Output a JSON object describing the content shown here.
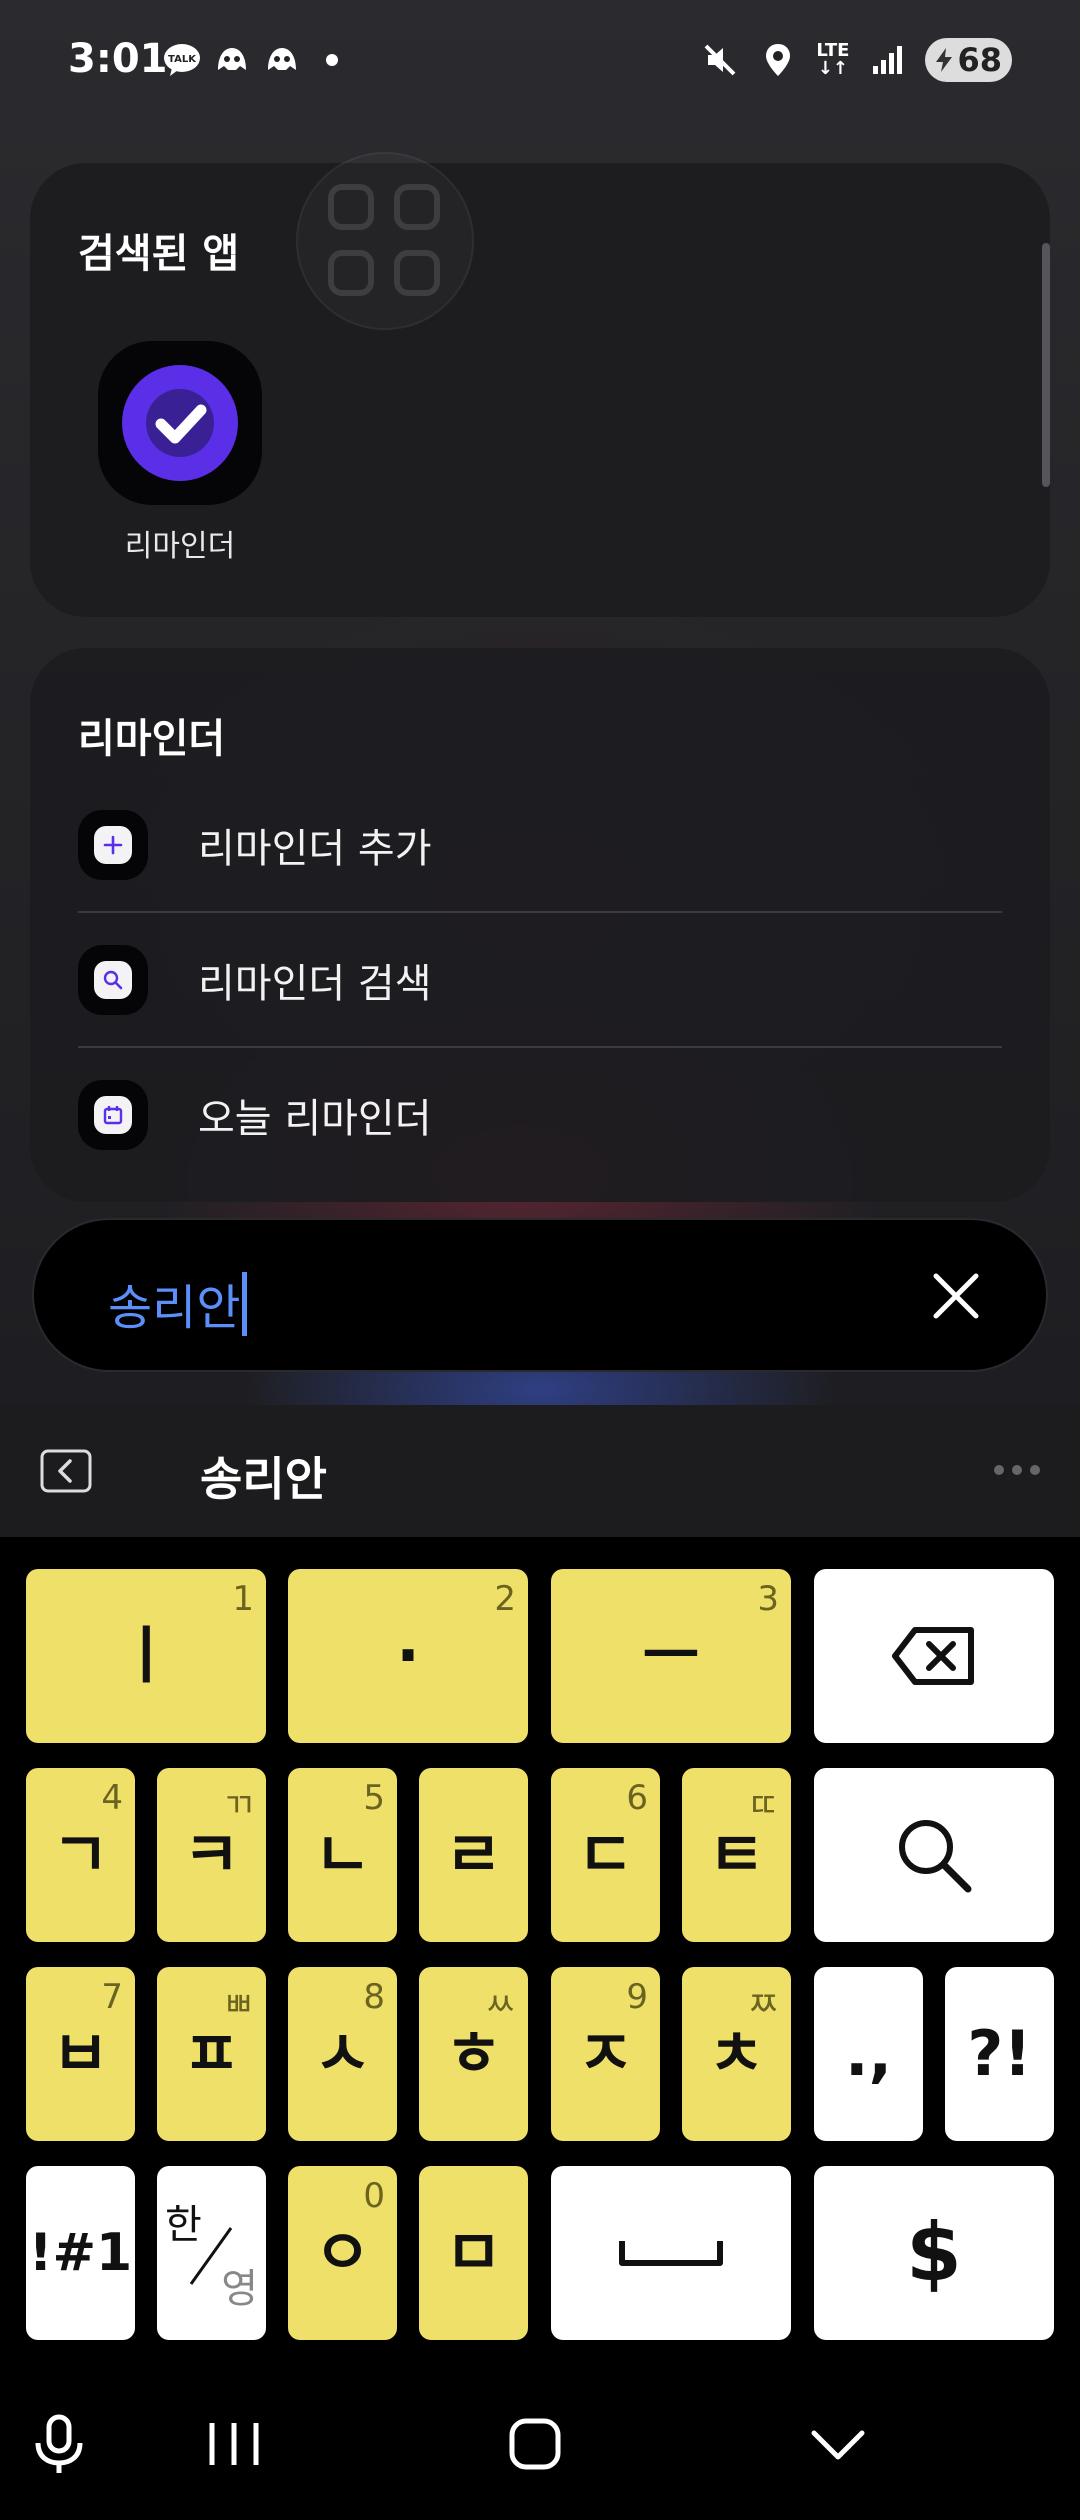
{
  "status_bar": {
    "time": "3:01",
    "battery": "68",
    "lte_top": "LTE",
    "lte_bottom": "↓↑",
    "left_icons": [
      "talk-icon",
      "discord-icon",
      "discord-icon",
      "dot-icon"
    ],
    "right_icons": [
      "mute-icon",
      "location-icon",
      "lte-icon",
      "signal-icon",
      "battery-icon"
    ]
  },
  "apps_card": {
    "title": "검색된 앱",
    "apps": [
      {
        "label": "리마인더",
        "icon": "reminder-check-icon"
      }
    ]
  },
  "reminder_card": {
    "title": "리마인더",
    "actions": [
      {
        "label": "리마인더 추가",
        "icon": "plus-icon"
      },
      {
        "label": "리마인더 검색",
        "icon": "search-icon"
      },
      {
        "label": "오늘 리마인더",
        "icon": "calendar-icon"
      }
    ]
  },
  "search": {
    "query": "송리안"
  },
  "keyboard": {
    "suggestion": "송리안",
    "row1": [
      {
        "main": "ㅣ",
        "sub": "1"
      },
      {
        "main": "·",
        "sub": "2"
      },
      {
        "main": "ㅡ",
        "sub": "3"
      }
    ],
    "row2": [
      {
        "main": "ㄱ",
        "sub": "4"
      },
      {
        "main": "ㅋ",
        "sub": "ㄲ"
      },
      {
        "main": "ㄴ",
        "sub": "5"
      },
      {
        "main": "ㄹ",
        "sub": ""
      },
      {
        "main": "ㄷ",
        "sub": "6"
      },
      {
        "main": "ㅌ",
        "sub": "ㄸ"
      }
    ],
    "row3": [
      {
        "main": "ㅂ",
        "sub": "7"
      },
      {
        "main": "ㅍ",
        "sub": "ㅃ"
      },
      {
        "main": "ㅅ",
        "sub": "8"
      },
      {
        "main": "ㅎ",
        "sub": "ㅆ"
      },
      {
        "main": "ㅈ",
        "sub": "9"
      },
      {
        "main": "ㅊ",
        "sub": "ㅉ"
      }
    ],
    "punct": ".,",
    "exclaim": "?!",
    "symbols": "!#1",
    "lang_top": "한",
    "lang_bottom": "영",
    "row4": [
      {
        "main": "ㅇ",
        "sub": "0"
      },
      {
        "main": "ㅁ",
        "sub": ""
      }
    ],
    "currency": "$"
  },
  "colors": {
    "key_yellow": "#efe06a",
    "accent_blue": "#5b8ff9",
    "reminder_purple": "#5b2ee8"
  }
}
